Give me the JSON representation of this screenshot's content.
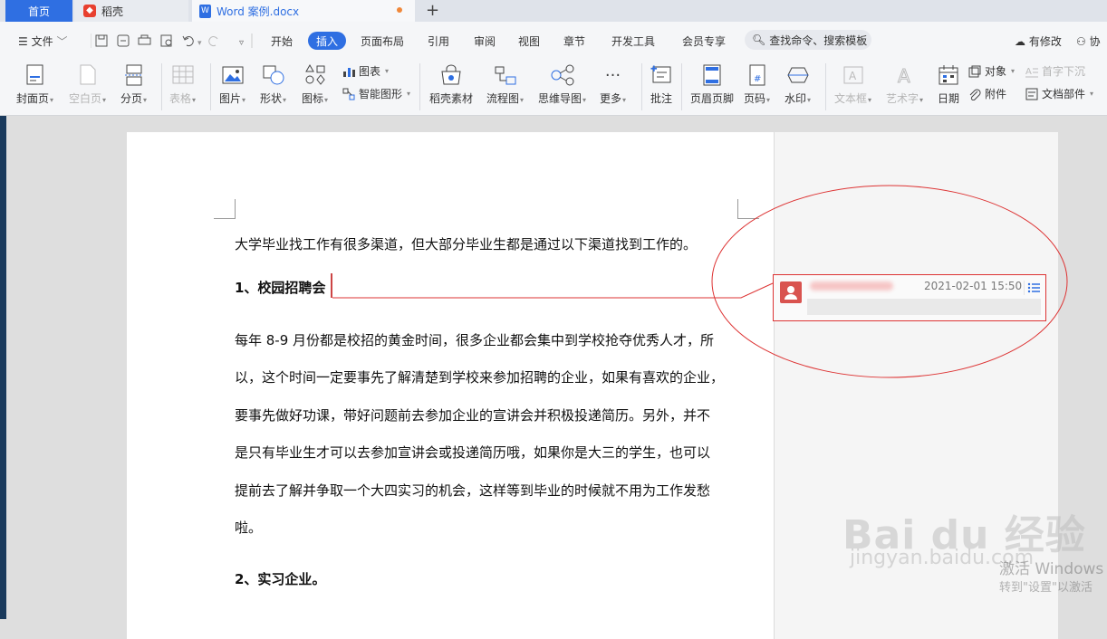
{
  "titlebar": {
    "tabs": [
      {
        "label": "首页"
      },
      {
        "label": "稻壳"
      },
      {
        "label": "Word 案例.docx"
      }
    ],
    "new_tab": "+"
  },
  "menubar": {
    "file_label": "文件",
    "tabs": [
      "开始",
      "插入",
      "页面布局",
      "引用",
      "审阅",
      "视图",
      "章节",
      "开发工具",
      "会员专享"
    ],
    "active_tab": "插入",
    "search_placeholder": "查找命令、搜索模板",
    "status_label": "有修改",
    "collab_label": "协"
  },
  "ribbon": {
    "cover": "封面页",
    "blank": "空白页",
    "pagebreak": "分页",
    "table": "表格",
    "picture": "图片",
    "shape": "形状",
    "icon": "图标",
    "chart": "图表",
    "smartart": "智能图形",
    "material": "稻壳素材",
    "flowchart": "流程图",
    "mindmap": "思维导图",
    "more": "更多",
    "annotate": "批注",
    "headerfooter": "页眉页脚",
    "pagenum": "页码",
    "watermark": "水印",
    "textbox": "文本框",
    "wordart": "艺术字",
    "date": "日期",
    "object": "对象",
    "attachment": "附件",
    "dropcap": "首字下沉",
    "docpart": "文档部件"
  },
  "document": {
    "intro": "大学毕业找工作有很多渠道，但大部分毕业生都是通过以下渠道找到工作的。",
    "heading1": "1、校园招聘会",
    "body_lines": [
      "每年 8-9 月份都是校招的黄金时间，很多企业都会集中到学校抢夺优秀人才，所",
      "以，这个时间一定要事先了解清楚到学校来参加招聘的企业，如果有喜欢的企业，",
      "要事先做好功课，带好问题前去参加企业的宣讲会并积极投递简历。另外，并不",
      "是只有毕业生才可以去参加宣讲会或投递简历哦，如果你是大三的学生，也可以",
      "提前去了解并争取一个大四实习的机会，这样等到毕业的时候就不用为工作发愁",
      "啦。"
    ],
    "heading2": "2、实习企业。"
  },
  "comment": {
    "timestamp": "2021-02-01 15:50"
  },
  "overlay": {
    "watermark_main": "Bai du 经验",
    "watermark_sub": "jingyan.baidu.com",
    "windows_line1": "激活 Windows",
    "windows_line2": "转到\"设置\"以激活"
  },
  "colors": {
    "accent": "#2f6fe2",
    "annotation": "#d33333"
  }
}
